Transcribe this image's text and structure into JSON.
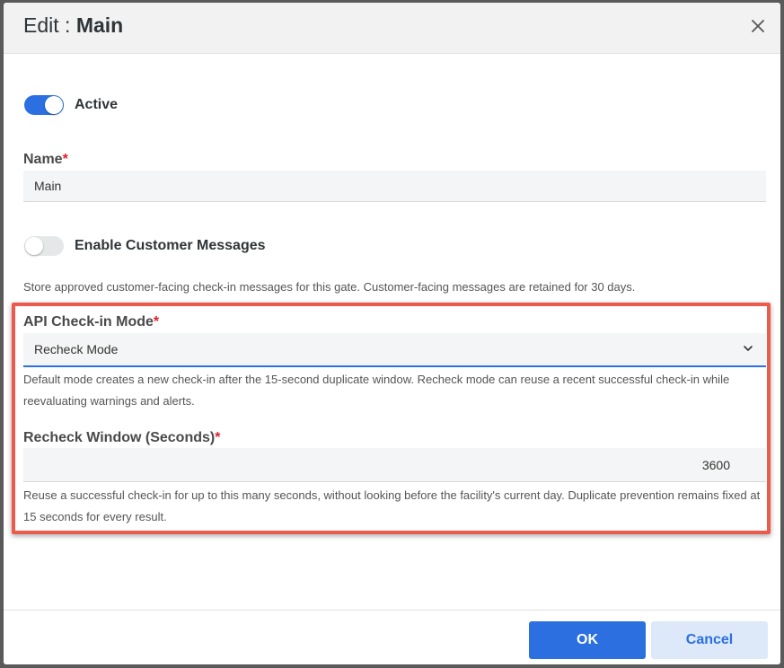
{
  "dialog": {
    "title_prefix": "Edit : ",
    "title_name": "Main",
    "close_icon": "close-icon"
  },
  "active_toggle": {
    "label": "Active",
    "on": true
  },
  "name_field": {
    "label": "Name",
    "required_mark": "*",
    "value": "Main"
  },
  "messages_toggle": {
    "label": "Enable Customer Messages",
    "on": false,
    "help": "Store approved customer-facing check-in messages for this gate. Customer-facing messages are retained for 30 days."
  },
  "api_mode": {
    "label": "API Check-in Mode",
    "required_mark": "*",
    "selected": "Recheck Mode",
    "help": "Default mode creates a new check-in after the 15-second duplicate window. Recheck mode can reuse a recent successful check-in while reevaluating warnings and alerts."
  },
  "recheck_window": {
    "label": "Recheck Window (Seconds)",
    "required_mark": "*",
    "value": "3600",
    "help": "Reuse a successful check-in for up to this many seconds, without looking before the facility's current day. Duplicate prevention remains fixed at 15 seconds for every result."
  },
  "footer": {
    "ok_label": "OK",
    "cancel_label": "Cancel"
  },
  "colors": {
    "accent": "#2b6fe0",
    "highlight": "#ec5a4c",
    "required": "#d9232e"
  }
}
